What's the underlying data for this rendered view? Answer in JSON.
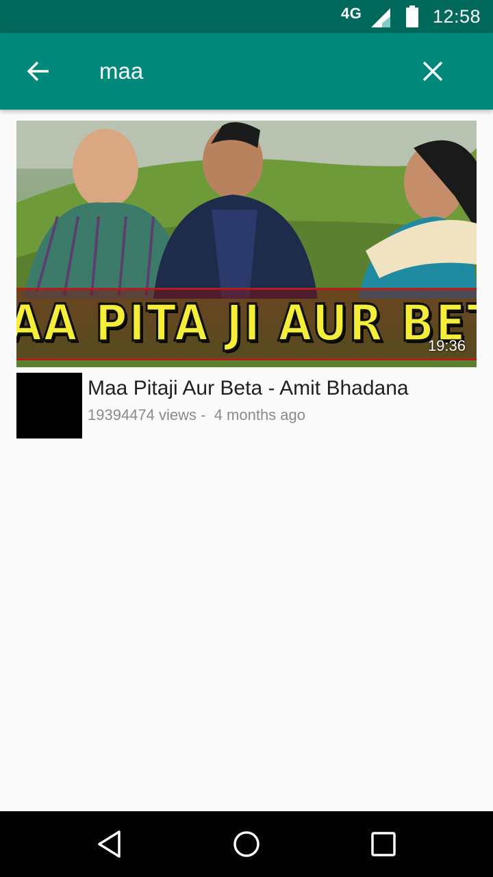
{
  "status_bar": {
    "network": "4G",
    "time": "12:58"
  },
  "app_bar": {
    "query": "maa",
    "back_icon": "arrow-left-icon",
    "clear_icon": "close-icon"
  },
  "results": [
    {
      "thumbnail_text": "MAA PITA JI AUR BETA",
      "duration": "19:36",
      "title": "Maa Pitaji Aur Beta - Amit Bhadana",
      "views": "19394474 views - ",
      "age": "4 months ago"
    }
  ],
  "nav_bar": {
    "back_icon": "triangle-back-icon",
    "home_icon": "circle-home-icon",
    "recents_icon": "square-recents-icon"
  },
  "colors": {
    "status_bar": "#00695c",
    "app_bar": "#00897b",
    "background": "#fafafa"
  }
}
